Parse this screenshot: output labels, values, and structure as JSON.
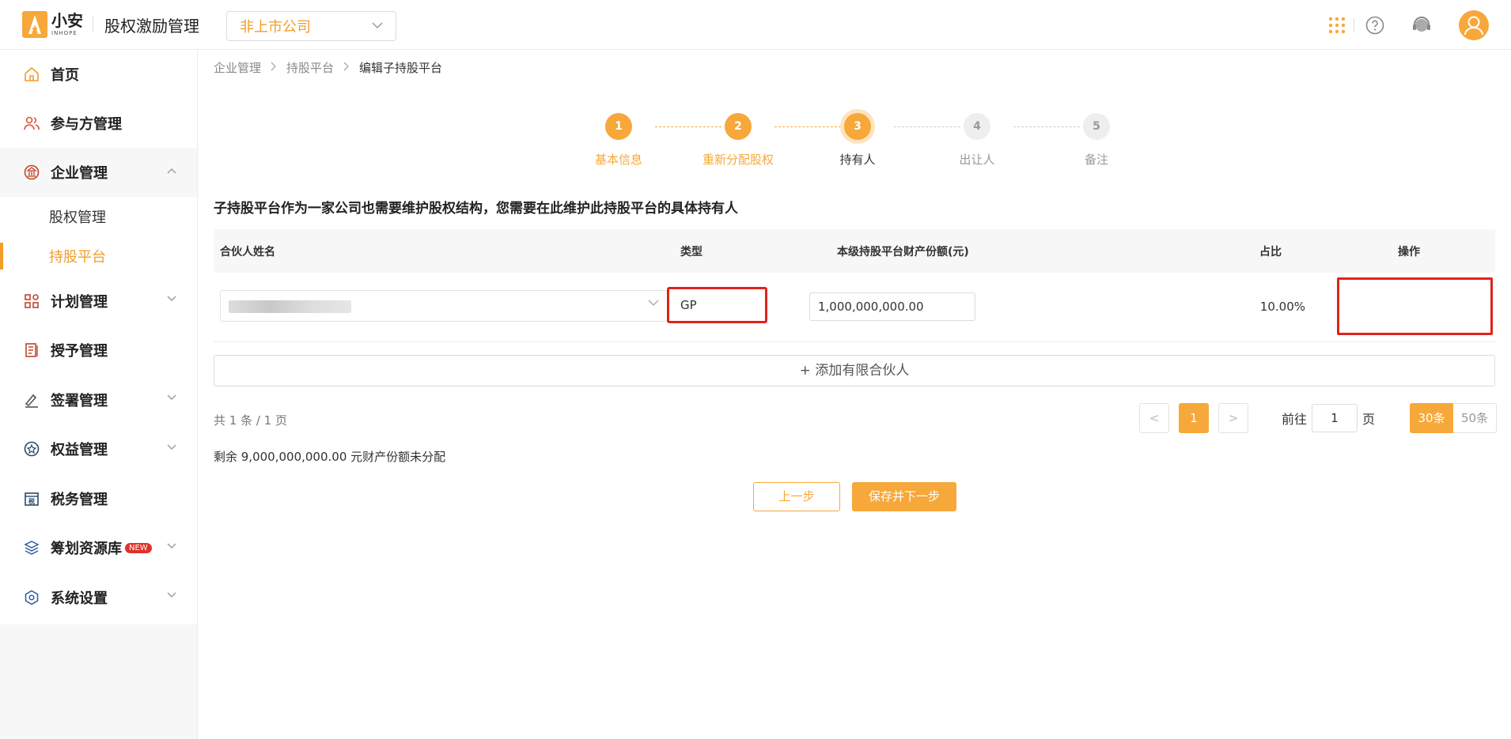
{
  "header": {
    "logo_cn": "小安",
    "logo_en": "INHOPE",
    "app_title": "股权激励管理",
    "company_select": "非上市公司",
    "icons": [
      "apps-grid-icon",
      "help-icon",
      "customer-service-icon",
      "user-avatar-icon"
    ]
  },
  "sidebar": {
    "items": [
      {
        "label": "首页",
        "icon": "home-icon"
      },
      {
        "label": "参与方管理",
        "icon": "users-icon"
      },
      {
        "label": "企业管理",
        "icon": "enterprise-icon",
        "expanded": true,
        "children": [
          {
            "label": "股权管理",
            "active": false
          },
          {
            "label": "持股平台",
            "active": true
          }
        ]
      },
      {
        "label": "计划管理",
        "icon": "plan-icon"
      },
      {
        "label": "授予管理",
        "icon": "grant-icon"
      },
      {
        "label": "签署管理",
        "icon": "sign-icon"
      },
      {
        "label": "权益管理",
        "icon": "equity-icon"
      },
      {
        "label": "税务管理",
        "icon": "tax-icon"
      },
      {
        "label": "筹划资源库",
        "icon": "layers-icon",
        "badge": "NEW"
      },
      {
        "label": "系统设置",
        "icon": "settings-icon"
      }
    ]
  },
  "breadcrumb": [
    "企业管理",
    "持股平台",
    "编辑子持股平台"
  ],
  "steps": [
    {
      "num": "1",
      "label": "基本信息",
      "state": "done"
    },
    {
      "num": "2",
      "label": "重新分配股权",
      "state": "done"
    },
    {
      "num": "3",
      "label": "持有人",
      "state": "current"
    },
    {
      "num": "4",
      "label": "出让人",
      "state": "todo"
    },
    {
      "num": "5",
      "label": "备注",
      "state": "todo"
    }
  ],
  "description": "子持股平台作为一家公司也需要维护股权结构，您需要在此维护此持股平台的具体持有人",
  "table": {
    "headers": [
      "合伙人姓名",
      "类型",
      "本级持股平台财产份额(元)",
      "占比",
      "操作"
    ],
    "rows": [
      {
        "name": "",
        "type": "GP",
        "amount": "1,000,000,000.00",
        "ratio": "10.00%",
        "ops": ""
      }
    ],
    "add_label": "+ 添加有限合伙人"
  },
  "pagination": {
    "total": "共 1 条 / 1 页",
    "prev": "<",
    "current_page": "1",
    "next": ">",
    "goto_label": "前往",
    "goto_value": "1",
    "page_unit": "页",
    "sizes": [
      "30条",
      "50条"
    ]
  },
  "remaining_text": "剩余 9,000,000,000.00 元财产份额未分配",
  "buttons": {
    "prev": "上一步",
    "next": "保存并下一步"
  },
  "colors": {
    "accent": "#f7a83a",
    "highlight_border": "#e0231a",
    "badge": "#e0312a"
  }
}
